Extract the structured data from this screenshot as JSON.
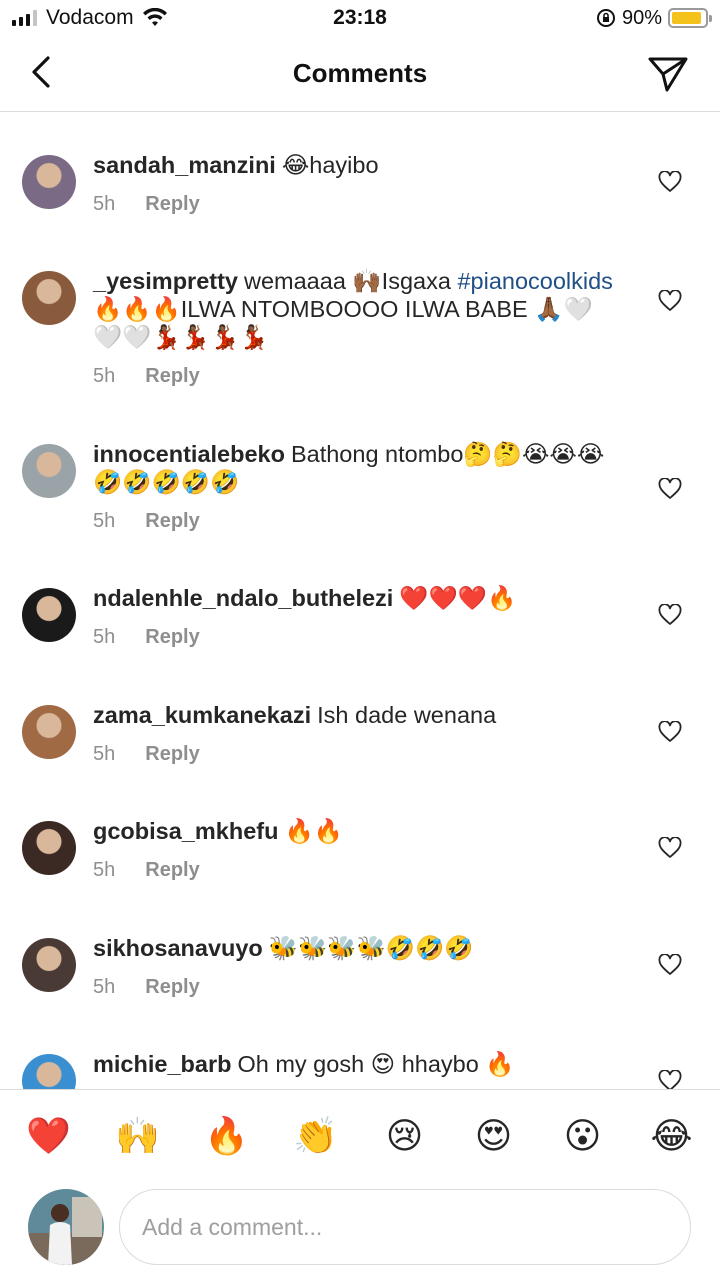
{
  "status_bar": {
    "carrier": "Vodacom",
    "time": "23:18",
    "battery": "90%",
    "battery_level": 0.9
  },
  "header": {
    "title": "Comments",
    "back_icon": "chevron-left-icon",
    "send_icon": "paper-plane-icon"
  },
  "comments": [
    {
      "username": "sandah_manzini",
      "segments": [
        {
          "t": "😂hayibo"
        }
      ],
      "time": "5h",
      "reply": "Reply",
      "avatar_color": "#7b6a86"
    },
    {
      "username": "_yesimpretty",
      "segments": [
        {
          "t": "wemaaaa 🙌🏾Isgaxa "
        },
        {
          "t": "#pianocoolkids",
          "tag": true
        },
        {
          "t": " 🔥🔥🔥ILWA NTOMBOOOO ILWA BABE 🙏🏾🤍🤍🤍💃🏾💃🏾💃🏾💃🏾"
        }
      ],
      "time": "5h",
      "reply": "Reply",
      "avatar_color": "#8a5a3c"
    },
    {
      "username": "innocentialebeko",
      "segments": [
        {
          "t": "Bathong ntombo🤔🤔😭😭😭🤣🤣🤣🤣🤣"
        }
      ],
      "time": "5h",
      "reply": "Reply",
      "avatar_color": "#9aa3a8"
    },
    {
      "username": "ndalenhle_ndalo_buthelezi",
      "segments": [
        {
          "t": "❤️❤️❤️🔥"
        }
      ],
      "time": "5h",
      "reply": "Reply",
      "avatar_color": "#1a1a1a"
    },
    {
      "username": "zama_kumkanekazi",
      "segments": [
        {
          "t": "Ish dade wenana"
        }
      ],
      "time": "5h",
      "reply": "Reply",
      "avatar_color": "#a06a45"
    },
    {
      "username": "gcobisa_mkhefu",
      "segments": [
        {
          "t": "🔥🔥"
        }
      ],
      "time": "5h",
      "reply": "Reply",
      "avatar_color": "#3b2a24"
    },
    {
      "username": "sikhosanavuyo",
      "segments": [
        {
          "t": "🐝🐝🐝🐝🤣🤣🤣"
        }
      ],
      "time": "5h",
      "reply": "Reply",
      "avatar_color": "#4a3a35"
    },
    {
      "username": "michie_barb",
      "segments": [
        {
          "t": "Oh my gosh 😍 hhaybo 🔥"
        }
      ],
      "time": "",
      "reply": "",
      "avatar_color": "#3a8fd0"
    }
  ],
  "quick_reactions": [
    "❤️",
    "🙌",
    "🔥",
    "👏",
    "😢",
    "😍",
    "😮",
    "😂"
  ],
  "composer": {
    "placeholder": "Add a comment..."
  }
}
